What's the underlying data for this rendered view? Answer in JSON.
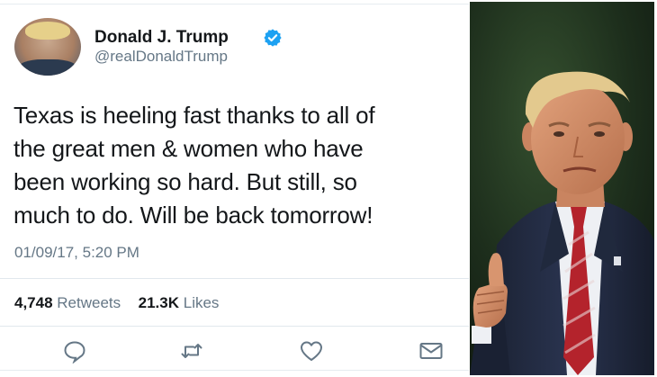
{
  "tweet": {
    "display_name": "Donald J. Trump",
    "handle": "@realDonaldTrump",
    "text_lines": [
      "Texas is heeling fast thanks to all of",
      "the great men & women who have",
      "been working so hard. But still, so",
      "much to do. Will be back tomorrow!"
    ],
    "timestamp": "01/09/17, 5:20 PM",
    "retweet_count": "4,748",
    "retweet_label": "Retweets",
    "like_count": "21.3K",
    "like_label": "Likes",
    "icons": {
      "verified": "verified-badge-icon",
      "reply": "reply-icon",
      "retweet": "retweet-icon",
      "like": "heart-icon",
      "message": "envelope-icon"
    }
  },
  "colors": {
    "verified_blue": "#1da1f2",
    "text_primary": "#14171a",
    "text_secondary": "#657786",
    "divider": "#e1e8ed"
  }
}
